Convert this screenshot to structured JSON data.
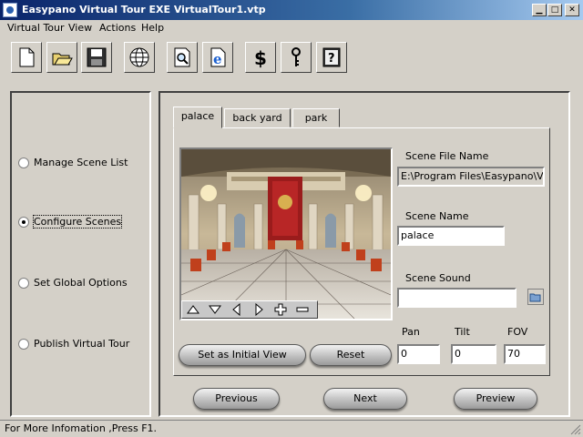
{
  "window": {
    "title": "Easypano Virtual Tour EXE  VirtualTour1.vtp",
    "controls": [
      "minimize-icon",
      "maximize-icon",
      "close-icon"
    ]
  },
  "menu": [
    {
      "label": "Virtual Tour"
    },
    {
      "label": "View"
    },
    {
      "label": "Actions"
    },
    {
      "label": "Help"
    }
  ],
  "toolbar": {
    "buttons": [
      "new-file-icon",
      "open-folder-icon",
      "save-disk-icon",
      "globe-icon",
      "preview-magnifier-icon",
      "internet-explorer-icon",
      "dollar-icon",
      "key-icon",
      "help-book-icon"
    ]
  },
  "steps": [
    {
      "label": "Manage Scene List",
      "checked": false
    },
    {
      "label": "Configure Scenes",
      "checked": true
    },
    {
      "label": "Set Global Options",
      "checked": false
    },
    {
      "label": "Publish Virtual Tour",
      "checked": false
    }
  ],
  "tabs": [
    {
      "label": "palace",
      "active": true
    },
    {
      "label": "back yard",
      "active": false
    },
    {
      "label": "park",
      "active": false
    }
  ],
  "viewer": {
    "controls": [
      "pan-up-icon",
      "pan-down-icon",
      "pan-left-icon",
      "pan-right-icon",
      "zoom-in-icon",
      "zoom-out-icon"
    ]
  },
  "scene": {
    "file_label": "Scene File Name",
    "file_value": "E:\\Program Files\\Easypano\\Virt",
    "name_label": "Scene Name",
    "name_value": "palace",
    "sound_label": "Scene Sound",
    "sound_value": "",
    "pan_label": "Pan",
    "pan_value": "0",
    "tilt_label": "Tilt",
    "tilt_value": "0",
    "fov_label": "FOV",
    "fov_value": "70"
  },
  "actions": {
    "set_initial": "Set as Initial View",
    "reset": "Reset",
    "previous": "Previous",
    "next": "Next",
    "preview": "Preview"
  },
  "status": {
    "text": "For More Infomation ,Press F1."
  },
  "colors": {
    "titlebar_start": "#0a246a",
    "titlebar_end": "#a6caf0",
    "window_face": "#d4d0c8"
  }
}
